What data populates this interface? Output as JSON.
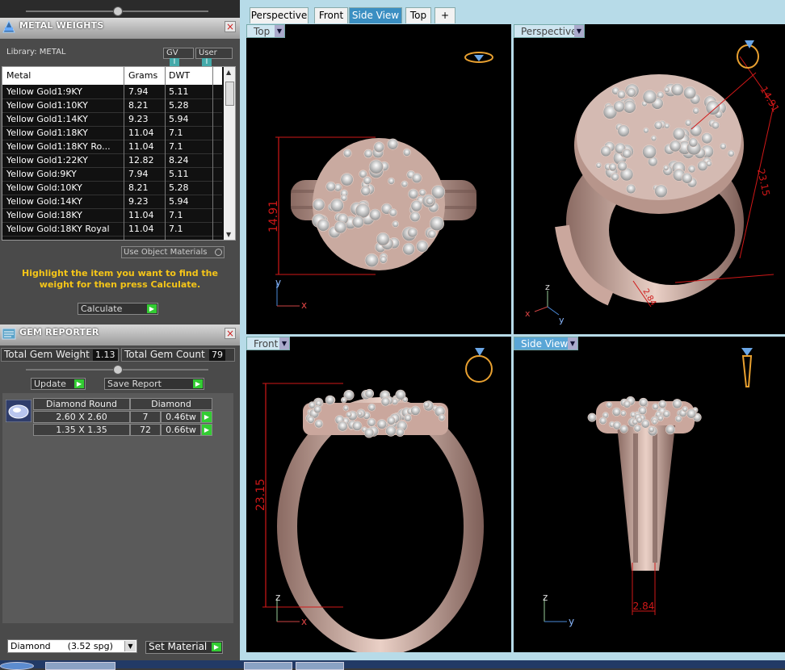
{
  "metal_panel": {
    "title": "METAL WEIGHTS",
    "library_label": "Library: METAL",
    "toggle_gv": "GV",
    "toggle_user": "User",
    "columns": [
      "Metal",
      "Grams",
      "DWT"
    ],
    "rows": [
      [
        "Yellow Gold1:9KY",
        "7.94",
        "5.11"
      ],
      [
        "Yellow Gold1:10KY",
        "8.21",
        "5.28"
      ],
      [
        "Yellow Gold1:14KY",
        "9.23",
        "5.94"
      ],
      [
        "Yellow Gold1:18KY",
        "11.04",
        "7.1"
      ],
      [
        "Yellow Gold1:18KY Ro...",
        "11.04",
        "7.1"
      ],
      [
        "Yellow Gold1:22KY",
        "12.82",
        "8.24"
      ],
      [
        "Yellow Gold:9KY",
        "7.94",
        "5.11"
      ],
      [
        "Yellow Gold:10KY",
        "8.21",
        "5.28"
      ],
      [
        "Yellow Gold:14KY",
        "9.23",
        "5.94"
      ],
      [
        "Yellow Gold:18KY",
        "11.04",
        "7.1"
      ],
      [
        "Yellow Gold:18KY Royal",
        "11.04",
        "7.1"
      ]
    ],
    "use_object_materials": "Use Object Materials",
    "hint": "Highlight the item you want to find the weight for then press Calculate.",
    "calculate_label": "Calculate"
  },
  "gem_panel": {
    "title": "GEM REPORTER",
    "total_weight_label": "Total Gem Weight",
    "total_weight_value": "1.13",
    "total_count_label": "Total Gem Count",
    "total_count_value": "79",
    "update_label": "Update",
    "save_report_label": "Save Report",
    "header_shape": "Diamond Round",
    "header_material": "Diamond",
    "gems": [
      {
        "size": "2.60 X 2.60",
        "count": "7",
        "weight": "0.46tw"
      },
      {
        "size": "1.35 X 1.35",
        "count": "72",
        "weight": "0.66tw"
      }
    ],
    "material_select": "Diamond      (3.52 spg)",
    "set_material_label": "Set Material"
  },
  "view_tabs": [
    "Perspective",
    "Front",
    "Side View",
    "Top",
    "+"
  ],
  "active_tab": "Side View",
  "viewports": {
    "top": {
      "label": "Top",
      "dimension": "14.91",
      "axis_a": "y",
      "axis_b": "x"
    },
    "perspective": {
      "label": "Perspective",
      "dim1": "14.91",
      "dim2": "23.15",
      "dim3": "2.84",
      "axis_z": "z",
      "axis_x": "x",
      "axis_y": "y"
    },
    "front": {
      "label": "Front",
      "dimension": "23.15",
      "axis_a": "z",
      "axis_b": "x"
    },
    "side": {
      "label": "Side View",
      "dimension": "2.84",
      "axis_a": "z",
      "axis_b": "y"
    }
  },
  "colors": {
    "accent_tab": "#3b8fc2",
    "hint_text": "#f5c518",
    "dimension_red": "#d01818",
    "metal_rose": "#d9b8ad",
    "viewport_bg": "#000000"
  }
}
